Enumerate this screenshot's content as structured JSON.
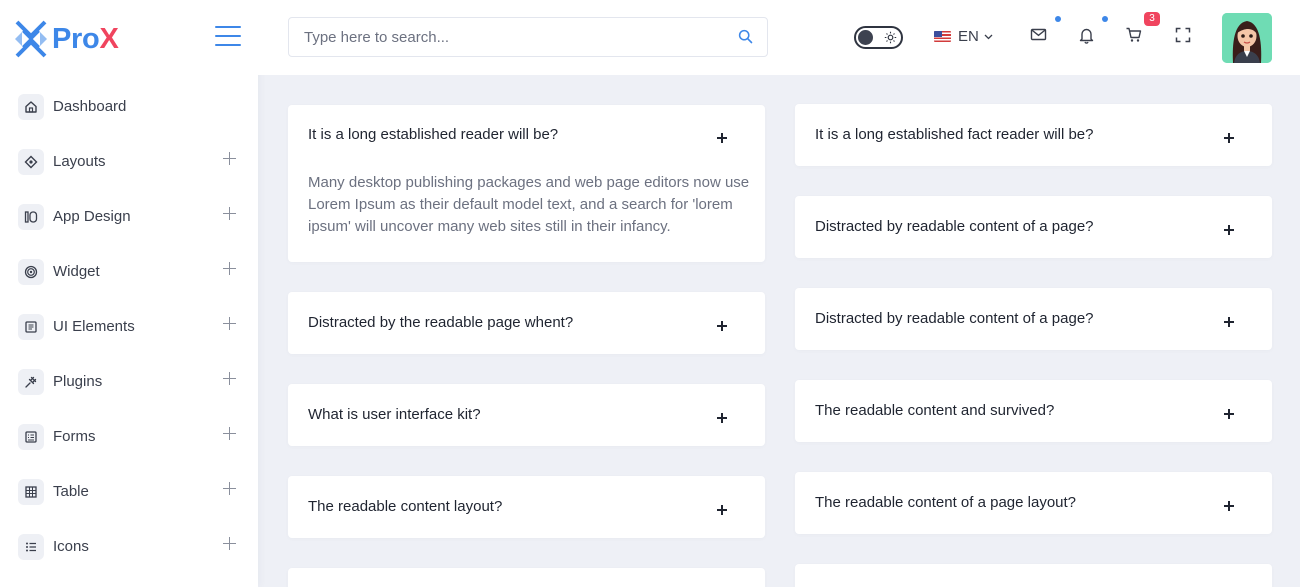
{
  "brand": {
    "name_part1": "Pro",
    "name_part2": "X",
    "primary_color": "#3d87e8",
    "accent_color": "#f0445e"
  },
  "sidebar": {
    "items": [
      {
        "label": "Dashboard",
        "icon": "home-icon",
        "expandable": false
      },
      {
        "label": "Layouts",
        "icon": "layout-icon",
        "expandable": true
      },
      {
        "label": "App Design",
        "icon": "app-design-icon",
        "expandable": true
      },
      {
        "label": "Widget",
        "icon": "widget-icon",
        "expandable": true
      },
      {
        "label": "UI Elements",
        "icon": "ui-elements-icon",
        "expandable": true
      },
      {
        "label": "Plugins",
        "icon": "plugin-icon",
        "expandable": true
      },
      {
        "label": "Forms",
        "icon": "forms-icon",
        "expandable": true
      },
      {
        "label": "Table",
        "icon": "table-icon",
        "expandable": true
      },
      {
        "label": "Icons",
        "icon": "list-icon",
        "expandable": true
      }
    ]
  },
  "topbar": {
    "search_placeholder": "Type here to search...",
    "language": "EN",
    "cart_count": "3"
  },
  "faq": {
    "left": [
      {
        "question": "It is a long established reader will be?",
        "expanded": true,
        "answer": "Many desktop publishing packages and web page editors now use Lorem Ipsum as their default model text, and a search for 'lorem ipsum' will uncover many web sites still in their infancy."
      },
      {
        "question": "Distracted by the readable page whent?",
        "expanded": false
      },
      {
        "question": "What is user interface kit?",
        "expanded": false
      },
      {
        "question": "The readable content layout?",
        "expanded": false
      }
    ],
    "right": [
      {
        "question": "It is a long established fact reader will be?",
        "expanded": false
      },
      {
        "question": "Distracted by readable content of a page?",
        "expanded": false
      },
      {
        "question": "Distracted by readable content of a page?",
        "expanded": false
      },
      {
        "question": "The readable content and survived?",
        "expanded": false
      },
      {
        "question": "The readable content of a page layout?",
        "expanded": false
      }
    ]
  }
}
